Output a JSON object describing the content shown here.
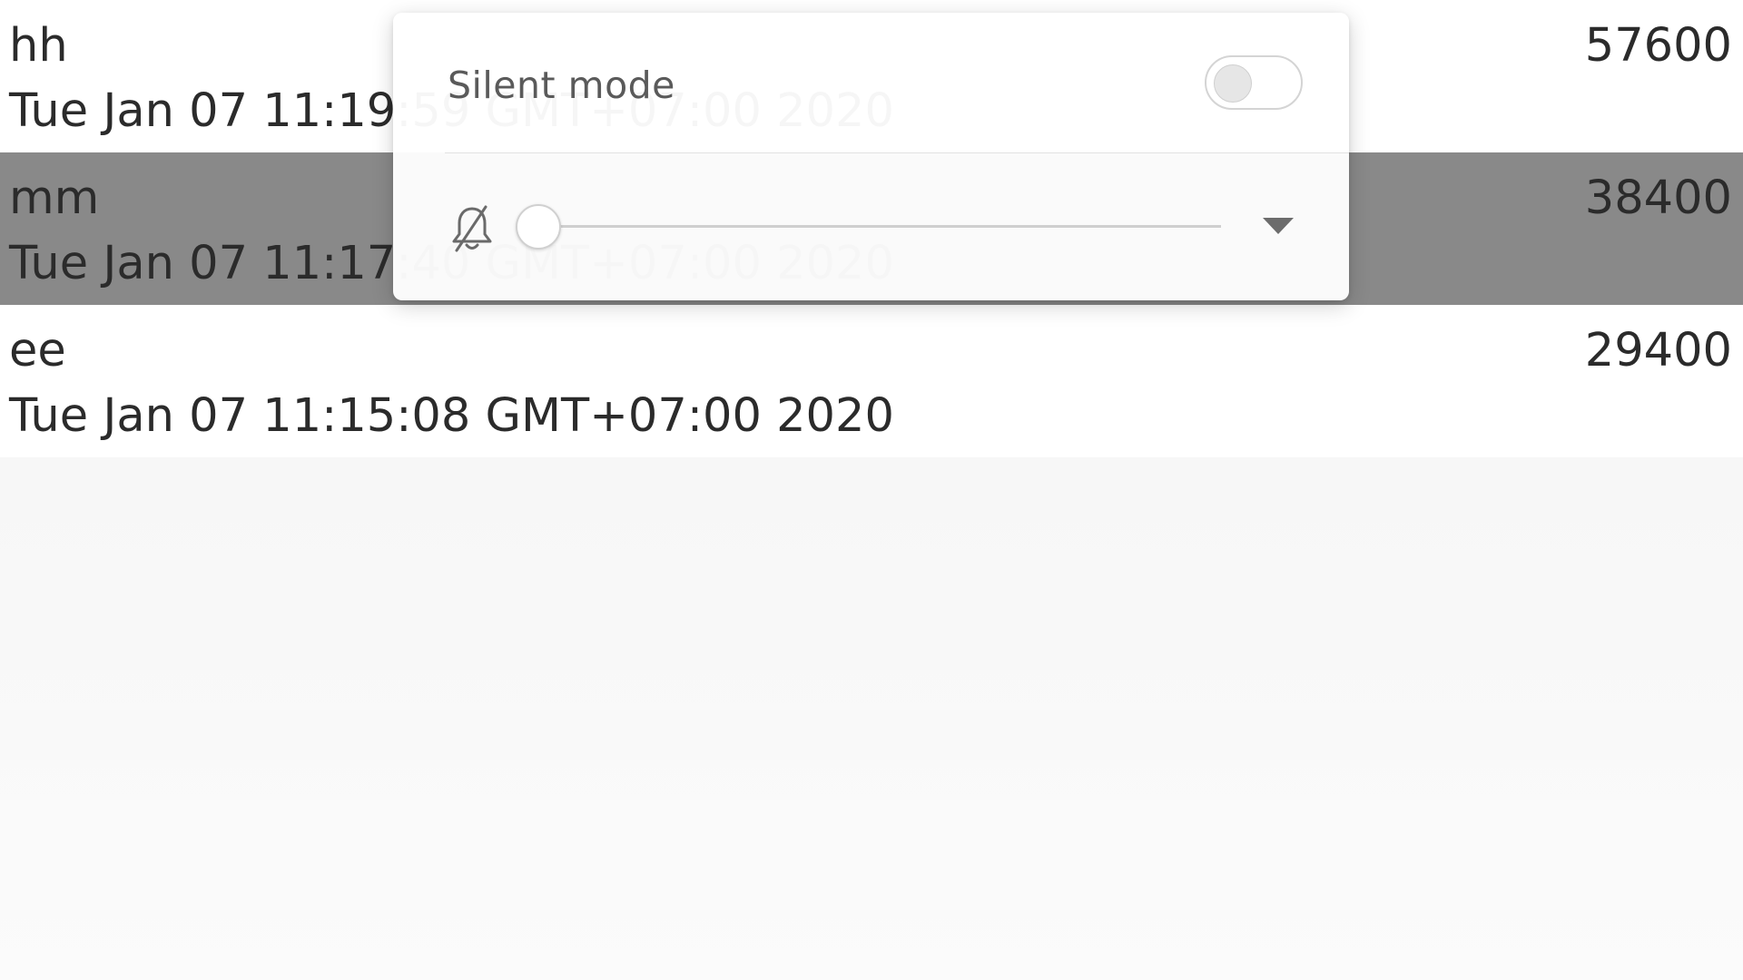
{
  "list": {
    "rows": [
      {
        "name": "hh",
        "date": "Tue Jan 07 11:19:59 GMT+07:00 2020",
        "value": "57600",
        "selected": false
      },
      {
        "name": "mm",
        "date": "Tue Jan 07 11:17:40 GMT+07:00 2020",
        "value": "38400",
        "selected": true
      },
      {
        "name": "ee",
        "date": "Tue Jan 07 11:15:08 GMT+07:00 2020",
        "value": "29400",
        "selected": false
      }
    ]
  },
  "volume_panel": {
    "silent_label": "Silent mode",
    "silent_mode_on": false,
    "volume_level": 0,
    "icons": {
      "volume": "bell-off-icon",
      "expand": "chevron-down-icon"
    }
  }
}
